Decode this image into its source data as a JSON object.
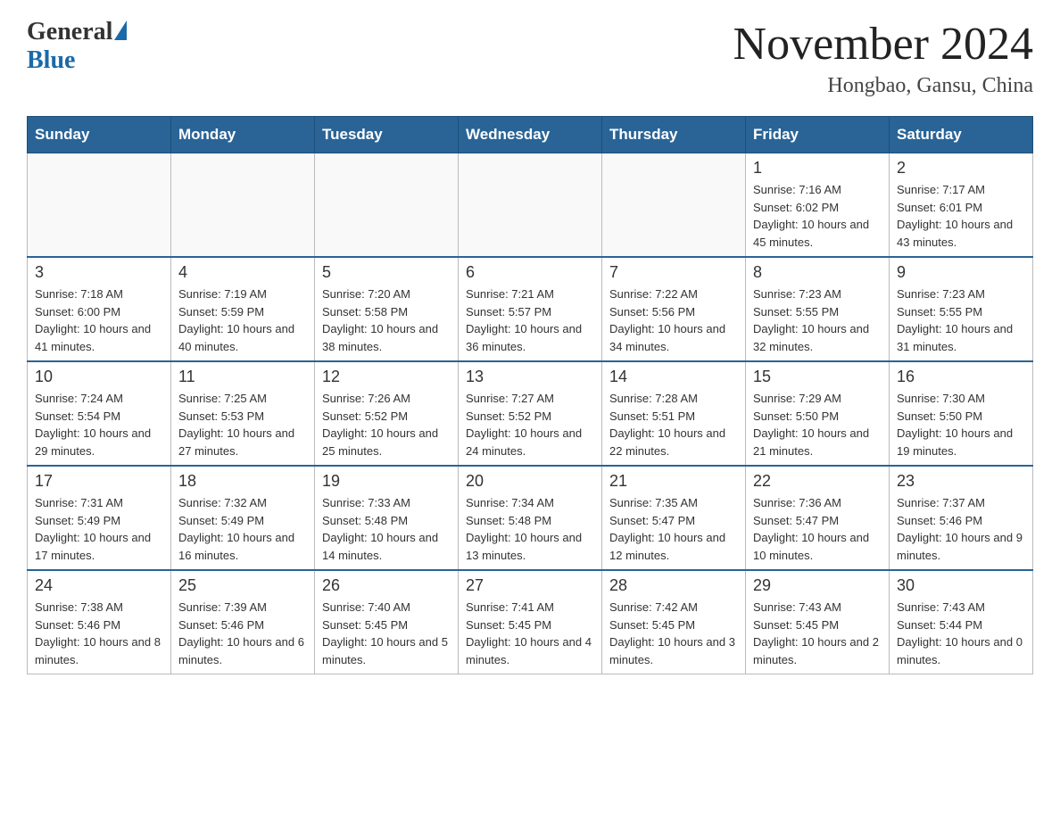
{
  "header": {
    "logo_general": "General",
    "logo_blue": "Blue",
    "title": "November 2024",
    "subtitle": "Hongbao, Gansu, China"
  },
  "days_of_week": [
    "Sunday",
    "Monday",
    "Tuesday",
    "Wednesday",
    "Thursday",
    "Friday",
    "Saturday"
  ],
  "weeks": [
    [
      {
        "day": "",
        "info": ""
      },
      {
        "day": "",
        "info": ""
      },
      {
        "day": "",
        "info": ""
      },
      {
        "day": "",
        "info": ""
      },
      {
        "day": "",
        "info": ""
      },
      {
        "day": "1",
        "info": "Sunrise: 7:16 AM\nSunset: 6:02 PM\nDaylight: 10 hours and 45 minutes."
      },
      {
        "day": "2",
        "info": "Sunrise: 7:17 AM\nSunset: 6:01 PM\nDaylight: 10 hours and 43 minutes."
      }
    ],
    [
      {
        "day": "3",
        "info": "Sunrise: 7:18 AM\nSunset: 6:00 PM\nDaylight: 10 hours and 41 minutes."
      },
      {
        "day": "4",
        "info": "Sunrise: 7:19 AM\nSunset: 5:59 PM\nDaylight: 10 hours and 40 minutes."
      },
      {
        "day": "5",
        "info": "Sunrise: 7:20 AM\nSunset: 5:58 PM\nDaylight: 10 hours and 38 minutes."
      },
      {
        "day": "6",
        "info": "Sunrise: 7:21 AM\nSunset: 5:57 PM\nDaylight: 10 hours and 36 minutes."
      },
      {
        "day": "7",
        "info": "Sunrise: 7:22 AM\nSunset: 5:56 PM\nDaylight: 10 hours and 34 minutes."
      },
      {
        "day": "8",
        "info": "Sunrise: 7:23 AM\nSunset: 5:55 PM\nDaylight: 10 hours and 32 minutes."
      },
      {
        "day": "9",
        "info": "Sunrise: 7:23 AM\nSunset: 5:55 PM\nDaylight: 10 hours and 31 minutes."
      }
    ],
    [
      {
        "day": "10",
        "info": "Sunrise: 7:24 AM\nSunset: 5:54 PM\nDaylight: 10 hours and 29 minutes."
      },
      {
        "day": "11",
        "info": "Sunrise: 7:25 AM\nSunset: 5:53 PM\nDaylight: 10 hours and 27 minutes."
      },
      {
        "day": "12",
        "info": "Sunrise: 7:26 AM\nSunset: 5:52 PM\nDaylight: 10 hours and 25 minutes."
      },
      {
        "day": "13",
        "info": "Sunrise: 7:27 AM\nSunset: 5:52 PM\nDaylight: 10 hours and 24 minutes."
      },
      {
        "day": "14",
        "info": "Sunrise: 7:28 AM\nSunset: 5:51 PM\nDaylight: 10 hours and 22 minutes."
      },
      {
        "day": "15",
        "info": "Sunrise: 7:29 AM\nSunset: 5:50 PM\nDaylight: 10 hours and 21 minutes."
      },
      {
        "day": "16",
        "info": "Sunrise: 7:30 AM\nSunset: 5:50 PM\nDaylight: 10 hours and 19 minutes."
      }
    ],
    [
      {
        "day": "17",
        "info": "Sunrise: 7:31 AM\nSunset: 5:49 PM\nDaylight: 10 hours and 17 minutes."
      },
      {
        "day": "18",
        "info": "Sunrise: 7:32 AM\nSunset: 5:49 PM\nDaylight: 10 hours and 16 minutes."
      },
      {
        "day": "19",
        "info": "Sunrise: 7:33 AM\nSunset: 5:48 PM\nDaylight: 10 hours and 14 minutes."
      },
      {
        "day": "20",
        "info": "Sunrise: 7:34 AM\nSunset: 5:48 PM\nDaylight: 10 hours and 13 minutes."
      },
      {
        "day": "21",
        "info": "Sunrise: 7:35 AM\nSunset: 5:47 PM\nDaylight: 10 hours and 12 minutes."
      },
      {
        "day": "22",
        "info": "Sunrise: 7:36 AM\nSunset: 5:47 PM\nDaylight: 10 hours and 10 minutes."
      },
      {
        "day": "23",
        "info": "Sunrise: 7:37 AM\nSunset: 5:46 PM\nDaylight: 10 hours and 9 minutes."
      }
    ],
    [
      {
        "day": "24",
        "info": "Sunrise: 7:38 AM\nSunset: 5:46 PM\nDaylight: 10 hours and 8 minutes."
      },
      {
        "day": "25",
        "info": "Sunrise: 7:39 AM\nSunset: 5:46 PM\nDaylight: 10 hours and 6 minutes."
      },
      {
        "day": "26",
        "info": "Sunrise: 7:40 AM\nSunset: 5:45 PM\nDaylight: 10 hours and 5 minutes."
      },
      {
        "day": "27",
        "info": "Sunrise: 7:41 AM\nSunset: 5:45 PM\nDaylight: 10 hours and 4 minutes."
      },
      {
        "day": "28",
        "info": "Sunrise: 7:42 AM\nSunset: 5:45 PM\nDaylight: 10 hours and 3 minutes."
      },
      {
        "day": "29",
        "info": "Sunrise: 7:43 AM\nSunset: 5:45 PM\nDaylight: 10 hours and 2 minutes."
      },
      {
        "day": "30",
        "info": "Sunrise: 7:43 AM\nSunset: 5:44 PM\nDaylight: 10 hours and 0 minutes."
      }
    ]
  ]
}
